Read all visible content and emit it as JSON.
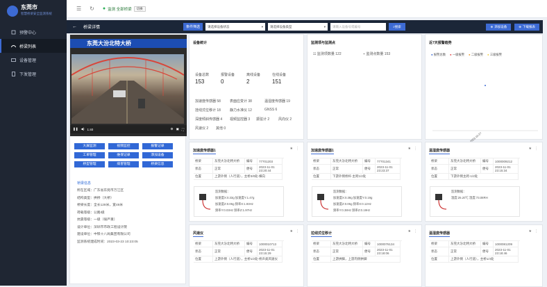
{
  "brand": {
    "title": "东莞市",
    "subtitle": "智慧桥梁安全监测系统"
  },
  "nav": [
    {
      "label": "预警中心"
    },
    {
      "label": "桥梁列表"
    },
    {
      "label": "设备管理"
    },
    {
      "label": "下发管理"
    }
  ],
  "topbar": {
    "location": "监测 全部桥梁",
    "location_btn": "切换"
  },
  "toolbar": {
    "title": "桥梁详情",
    "filter": "条件筛选",
    "select1": "请选择设备状态",
    "select2": "请选择设备类型",
    "input_placeholder": "请输入设备号或编号",
    "search": "搜索",
    "add": "添加设备",
    "report": "下载报表"
  },
  "bridge": {
    "name": "东莞大汾北特大桥",
    "video_time": "1:40",
    "buttons": [
      "大屏监测",
      "视频监控",
      "报警记录",
      "工单管理",
      "维保记录",
      "添加设备",
      "桥型管理",
      "病害管理",
      "桥梁信息"
    ],
    "info_title": "桥梁信息",
    "info": [
      "所在区域：广东省东莞市万江区",
      "结构类型：拱桥（大桥）",
      "桥梁长度：全长128米，宽48米",
      "荷载等级：公路I级",
      "抗震等级：一级（很严重）",
      "设计单位：深圳市市政工程设计院",
      "建设单位：中铁十八局集团有限公司",
      "监测系统建成时间：2023-03-23 10:23:05"
    ]
  },
  "device_stats": {
    "title": "设备统计",
    "items": [
      {
        "label": "设备总数",
        "value": "153"
      },
      {
        "label": "报警设备",
        "value": "0"
      },
      {
        "label": "离线设备",
        "value": "2"
      },
      {
        "label": "在线设备",
        "value": "151"
      }
    ],
    "types": [
      "加速度传感器 58",
      "表面应变计 38",
      "温湿度传感器 19",
      "挂线式位移计 18",
      "静力水准仪 12",
      "GNSS 6",
      "深度倾斜传感器 4",
      "视频监控器 3",
      "振弦计 2",
      "风向仪 2",
      "风速仪 2",
      "其他 0"
    ]
  },
  "monitor": {
    "title": "监测项与监测点",
    "items": [
      "监测项数量 122",
      "监测点数量 153"
    ]
  },
  "trend": {
    "title": "近7天报警趋势",
    "legend": [
      "报警总数",
      "一级报警",
      "二级报警",
      "三级报警"
    ],
    "legend_colors": [
      "#3d6bd4",
      "#e64a4a",
      "#f0a030",
      "#f4d03f"
    ],
    "x_label": "2023-10-27"
  },
  "sensors": [
    {
      "title": "加速度传感器1",
      "rows": [
        {
          "k": "桥梁",
          "v": "东莞大汾北特大桥",
          "k2": "编号",
          "v2": "77701203"
        },
        {
          "k": "状态",
          "v": "正常",
          "k2": "便号",
          "v2": "2023-11-01 23:20:44"
        },
        {
          "k": "位置",
          "v": "上游外侧（人行道），主桥3/8处-横向"
        }
      ],
      "data": [
        "监测数据：",
        "加速度X:0.33g   加速度Y:1.47g",
        "加速度Z:0.06g   频率X:1.93Hz",
        "频率Y:0.03Hz   频率Z:1.97Hz"
      ]
    },
    {
      "title": "加速度传感器1",
      "rows": [
        {
          "k": "桥梁",
          "v": "东莞大汾北特大桥",
          "k2": "编号",
          "v2": "77701341"
        },
        {
          "k": "状态",
          "v": "正常",
          "k2": "便号",
          "v2": "2023-11-01 23:23:37"
        },
        {
          "k": "位置",
          "v": "下游外侧桥杆-主跨1/2处"
        }
      ],
      "data": [
        "监测数据：",
        "加速度X:0.38g   加速度Y:0.19g",
        "加速度Z:0.06g   频率X:0.12Hz",
        "频率Y:0.38Hz   频率Z:0.19Hz"
      ]
    },
    {
      "title": "温湿度传感器",
      "rows": [
        {
          "k": "桥梁",
          "v": "东莞大汾北特大桥",
          "k2": "编号",
          "v2": "1000009212"
        },
        {
          "k": "状态",
          "v": "正常",
          "k2": "便号",
          "v2": "2023-11-01 23:15:34"
        },
        {
          "k": "位置",
          "v": "下游外侧主跨-1/2处"
        }
      ],
      "data": [
        "监测数据：",
        "温度:25.20℃   湿度:73.08RH"
      ]
    },
    {
      "title": "风速仪",
      "rows": [
        {
          "k": "桥梁",
          "v": "东莞大汾北特大桥",
          "k2": "编号",
          "v2": "1000010713"
        },
        {
          "k": "状态",
          "v": "正常",
          "k2": "便号",
          "v2": "2023-11-01 23:15:29"
        },
        {
          "k": "位置",
          "v": "上游外侧（人行道），主桥1/2处-桥声类风速仪"
        }
      ]
    },
    {
      "title": "拉线式位移计",
      "rows": [
        {
          "k": "桥梁",
          "v": "东莞大汾北特大桥",
          "k2": "编号",
          "v2": "1000076134"
        },
        {
          "k": "状态",
          "v": "正常",
          "k2": "便号",
          "v2": "2023-11-01 23:18:06"
        },
        {
          "k": "位置",
          "v": "上游拱脚，上游内侧拱脚"
        }
      ]
    },
    {
      "title": "温湿度传感器",
      "rows": [
        {
          "k": "桥梁",
          "v": "东莞大汾北特大桥",
          "k2": "编号",
          "v2": "1000081209"
        },
        {
          "k": "状态",
          "v": "正常",
          "k2": "便号",
          "v2": "2023-11-01 23:18:46"
        },
        {
          "k": "位置",
          "v": "上游外侧（人行道），主桥1/4处"
        }
      ]
    }
  ]
}
